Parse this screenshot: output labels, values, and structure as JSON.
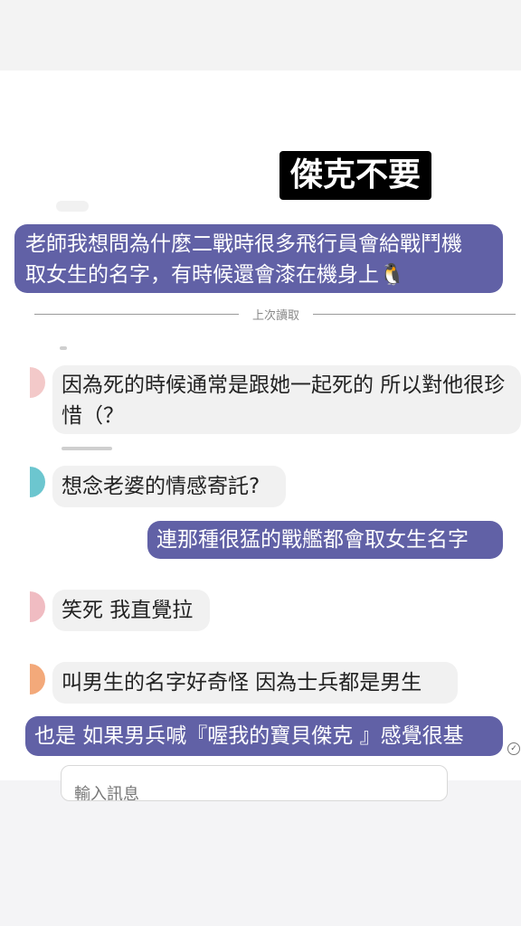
{
  "caption": "傑克不要",
  "divider": "上次讀取",
  "messages": [
    {
      "line1": "老師我想問為什麼二戰時很多飛行員會給戰鬥機",
      "line2": "取女生的名字，有時候還會漆在機身上🐧"
    },
    {
      "line1": "因為死的時候通常是跟她一起死的 所以對他很珍",
      "line2": "惜（？"
    },
    {
      "text": "想念老婆的情感寄託?"
    },
    {
      "text": "連那種很猛的戰艦都會取女生名字"
    },
    {
      "text": "笑死 我直覺拉"
    },
    {
      "text": "叫男生的名字好奇怪 因為士兵都是男生"
    },
    {
      "text": "也是 如果男兵喊『喔我的寶貝傑克 』感覺很基"
    }
  ],
  "input": {
    "placeholder": "輸入訊息"
  },
  "colors": {
    "sent_bubble": "#6161a6",
    "received_bubble": "#f1f1f1",
    "caption_bg": "#000000"
  }
}
